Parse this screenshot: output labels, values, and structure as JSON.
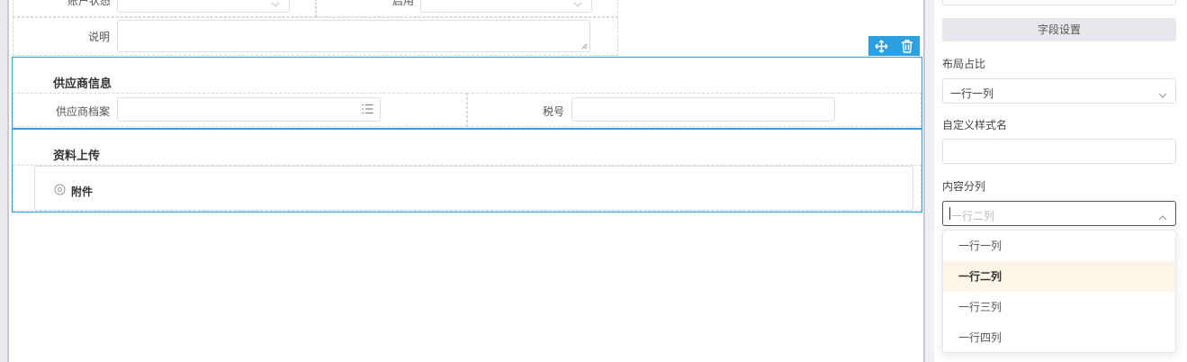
{
  "form": {
    "row_account_status_label": "账户状态",
    "row_enabled_label": "启用",
    "description_label": "说明",
    "supplier_section_title": "供应商信息",
    "supplier_file_label": "供应商档案",
    "tax_no_label": "税号",
    "upload_section_title": "资料上传",
    "attachment_label": "附件"
  },
  "panel": {
    "field_settings_button": "字段设置",
    "layout_ratio_label": "布局占比",
    "layout_ratio_value": "一行一列",
    "custom_style_label": "自定义样式名",
    "custom_style_value": "",
    "content_columns_label": "内容分列",
    "content_columns_placeholder": "一行二列",
    "content_columns_options": [
      "一行一列",
      "一行二列",
      "一行三列",
      "一行四列"
    ],
    "content_columns_selected_index": 1
  },
  "icons": [
    "move-icon",
    "trash-icon",
    "list-icon",
    "chevron-down-icon",
    "chevron-up-icon",
    "attachment-icon"
  ],
  "colors": {
    "accent": "#2ea0e0",
    "selected_option_bg": "#fdf6e8"
  }
}
